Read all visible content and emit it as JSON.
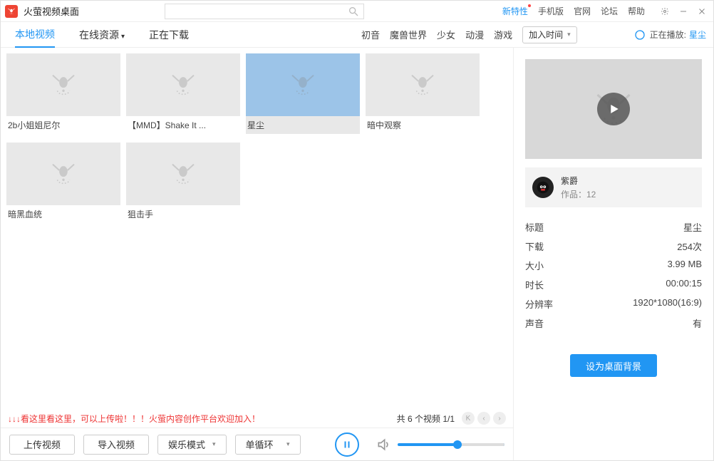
{
  "app": {
    "title": "火萤视频桌面"
  },
  "titlebar_links": {
    "new": "新特性",
    "mobile": "手机版",
    "official": "官网",
    "forum": "论坛",
    "help": "帮助"
  },
  "search": {
    "placeholder": ""
  },
  "tabs": {
    "local": "本地视频",
    "online": "在线资源",
    "downloading": "正在下载"
  },
  "categories": [
    "初音",
    "魔兽世界",
    "少女",
    "动漫",
    "游戏"
  ],
  "sort": {
    "label": "加入时间"
  },
  "now_playing": {
    "prefix": "正在播放:",
    "track": "星尘"
  },
  "videos": [
    {
      "title": "2b小姐姐尼尔",
      "selected": false
    },
    {
      "title": "【MMD】Shake It ...",
      "selected": false
    },
    {
      "title": "星尘",
      "selected": true
    },
    {
      "title": "暗中观察",
      "selected": false
    },
    {
      "title": "暗黑血统",
      "selected": false
    },
    {
      "title": "狙击手",
      "selected": false
    }
  ],
  "footer": {
    "message": "↓↓↓看这里看这里，可以上传啦！！！火萤内容创作平台欢迎加入！",
    "count": "共 6 个视频  1/1"
  },
  "bottom": {
    "upload": "上传视频",
    "import": "导入视频",
    "mode": "娱乐模式",
    "loop": "单循环"
  },
  "detail": {
    "author_name": "紫爵",
    "works_label": "作品：12",
    "rows": [
      {
        "k": "标题",
        "v": "星尘"
      },
      {
        "k": "下载",
        "v": "254次"
      },
      {
        "k": "大小",
        "v": "3.99 MB"
      },
      {
        "k": "时长",
        "v": "00:00:15"
      },
      {
        "k": "分辨率",
        "v": "1920*1080(16:9)"
      },
      {
        "k": "声音",
        "v": "有"
      }
    ],
    "set_button": "设为桌面背景"
  }
}
